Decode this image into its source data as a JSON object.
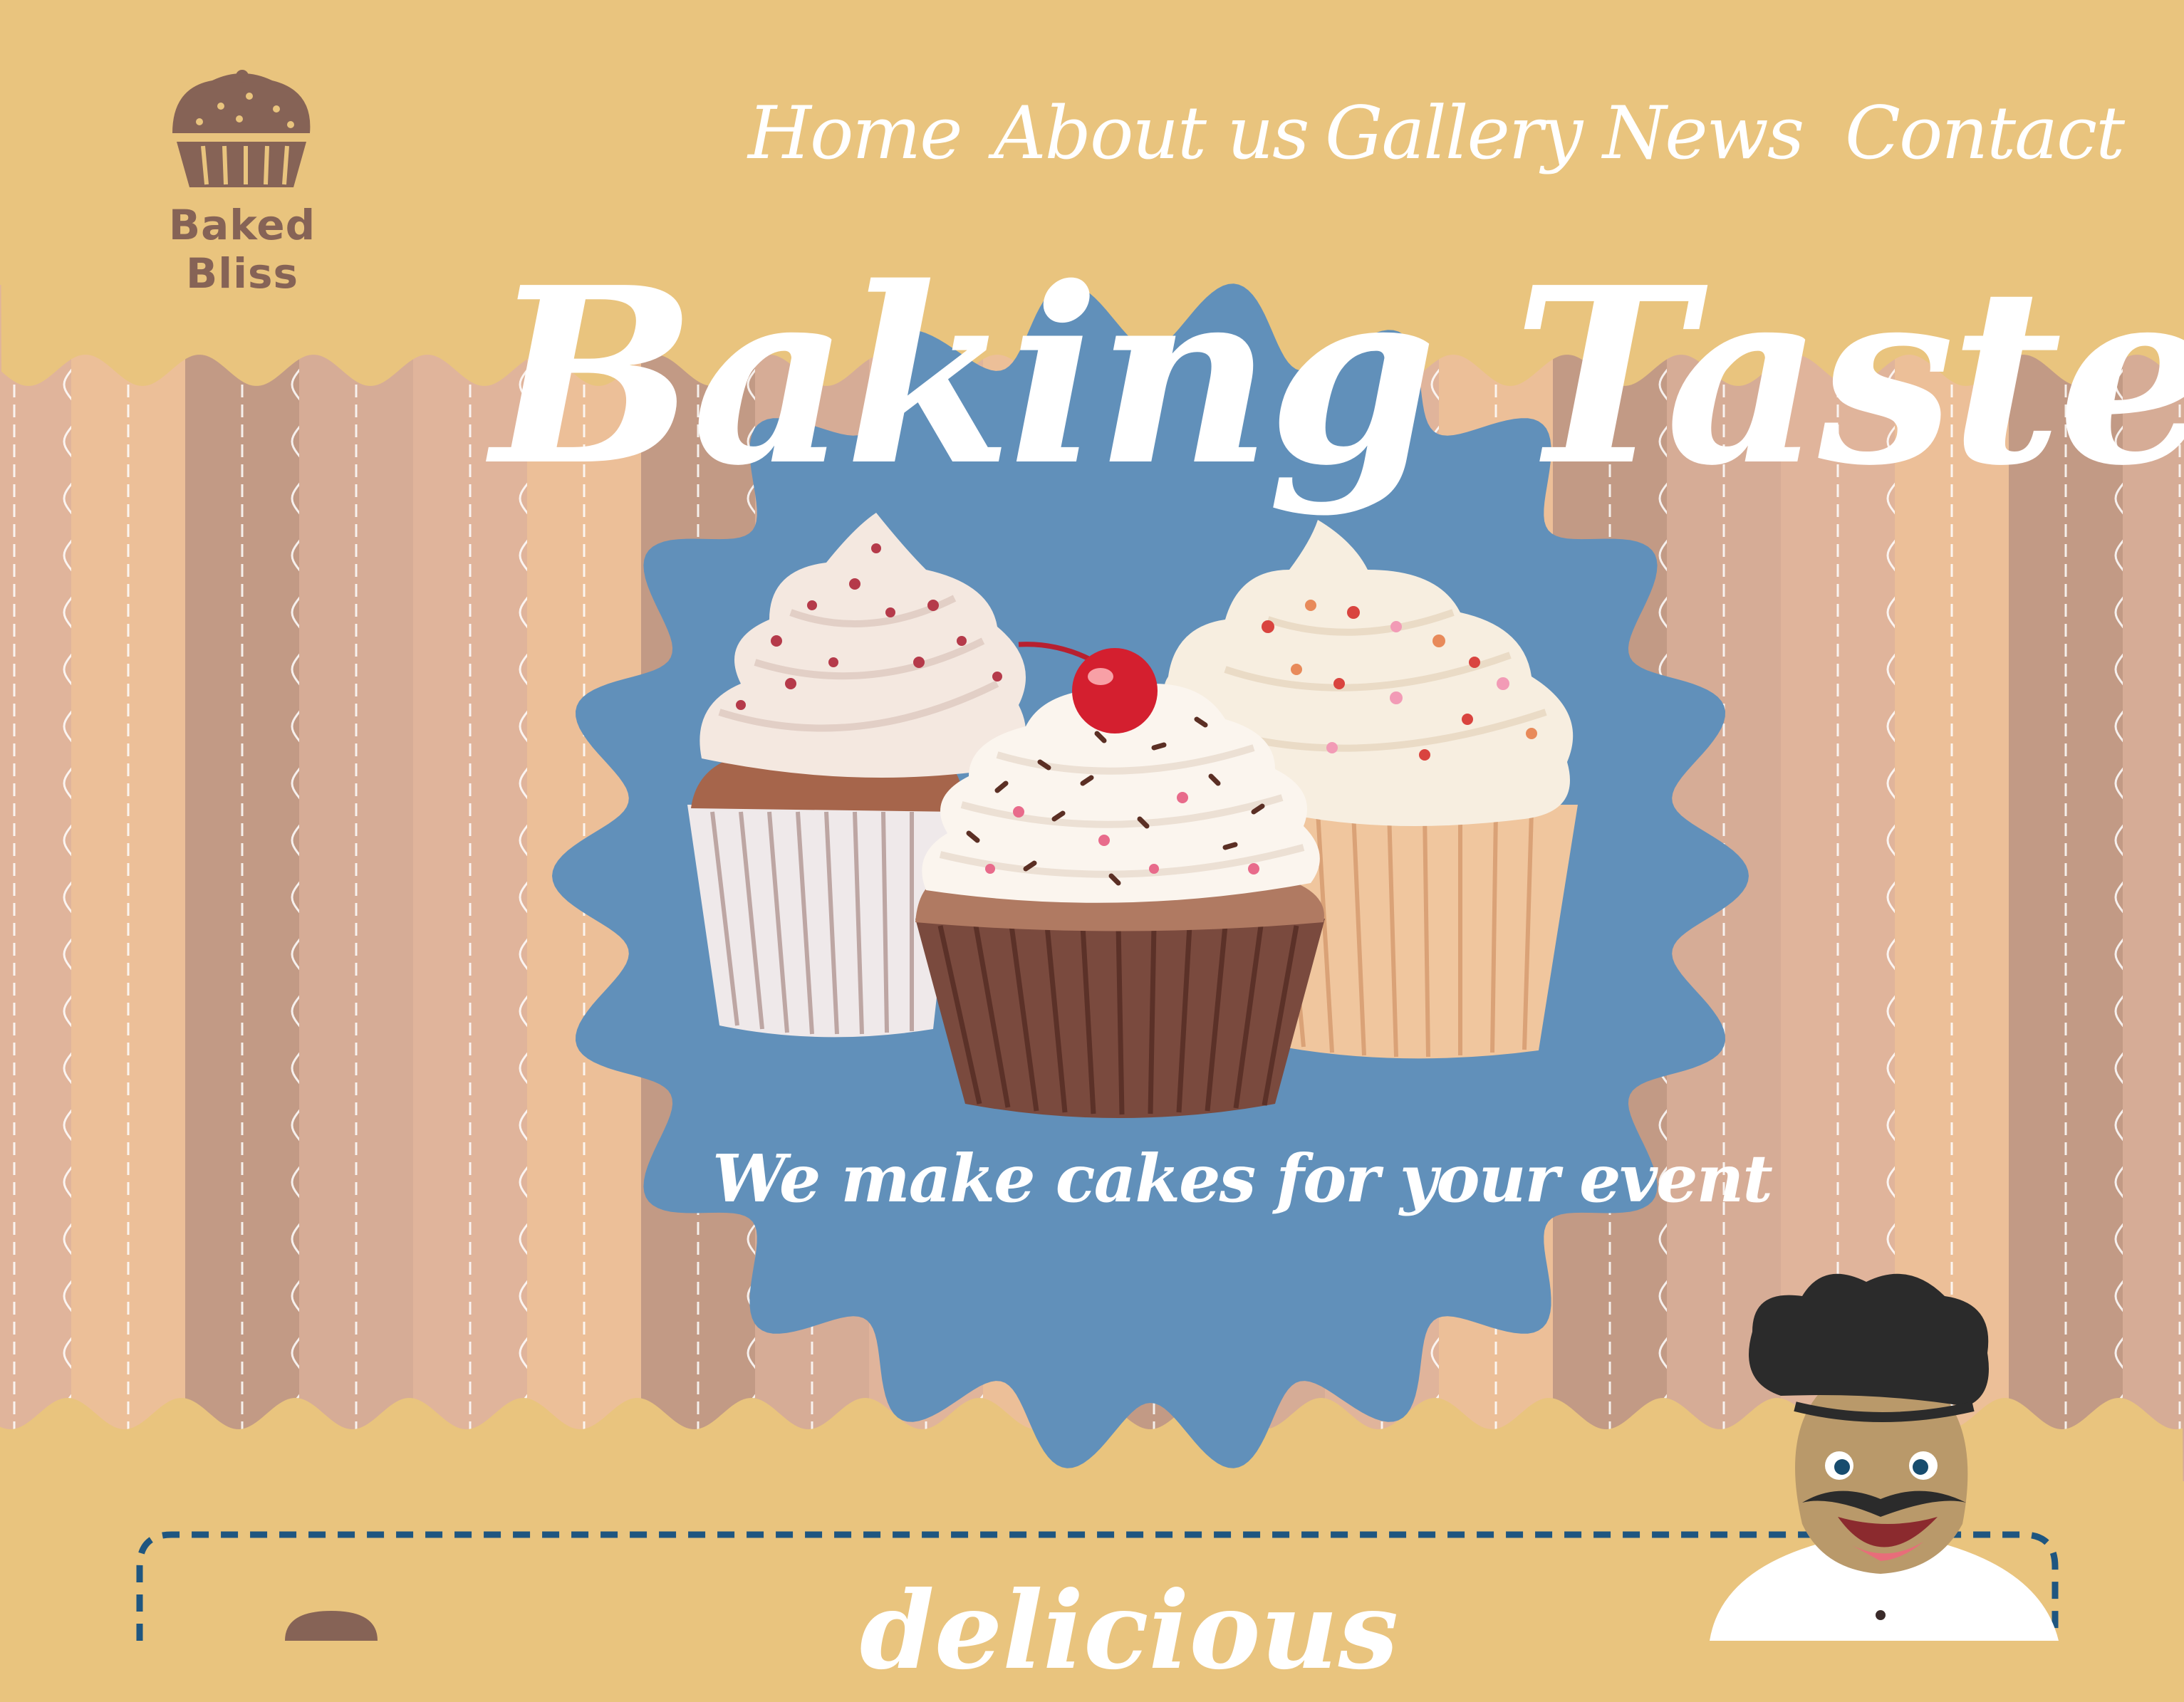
{
  "brand": {
    "name": "Baked Bliss",
    "logo_icon": "cupcake-icon"
  },
  "nav": {
    "items": [
      {
        "label": "Home"
      },
      {
        "label": "About us"
      },
      {
        "label": "Gallery"
      },
      {
        "label": "News"
      },
      {
        "label": "Contact"
      }
    ]
  },
  "hero": {
    "title": "Baking Taste",
    "subtitle": "We make cakes for your event",
    "image": "three-cupcakes-illustration"
  },
  "section": {
    "heading": "delicious"
  },
  "mascot": {
    "icon": "chef-mascot-icon"
  },
  "colors": {
    "header_bg": "#e9c47e",
    "badge_blue": "#6190ba",
    "logo_brown": "#866356",
    "stripes": [
      "#e0b49b",
      "#ecbf98",
      "#c29a85",
      "#d6ac96"
    ],
    "text_white": "#ffffff"
  }
}
